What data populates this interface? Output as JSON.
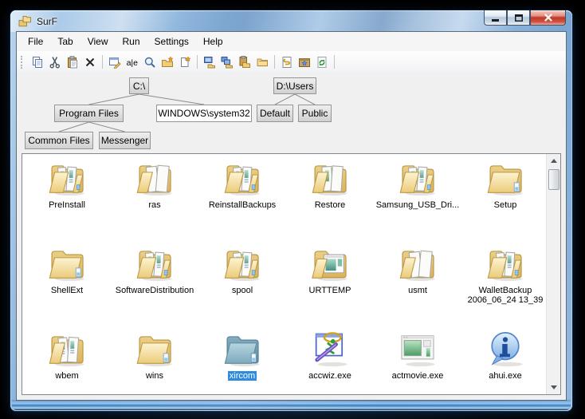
{
  "window": {
    "title": "SurF",
    "app_icon": "folders-app-icon",
    "controls": [
      {
        "name": "minimize-button",
        "icon": "minimize-icon"
      },
      {
        "name": "maximize-button",
        "icon": "maximize-icon"
      },
      {
        "name": "close-button",
        "icon": "close-icon"
      }
    ]
  },
  "menu": {
    "items": [
      "File",
      "Tab",
      "View",
      "Run",
      "Settings",
      "Help"
    ]
  },
  "toolbar": {
    "items": [
      {
        "name": "copy-icon"
      },
      {
        "name": "cut-icon"
      },
      {
        "name": "paste-icon"
      },
      {
        "name": "delete-icon"
      },
      {
        "name": "separator"
      },
      {
        "name": "properties-icon"
      },
      {
        "name": "rename-icon"
      },
      {
        "name": "search-icon"
      },
      {
        "name": "new-folder-icon"
      },
      {
        "name": "new-file-icon"
      },
      {
        "name": "separator"
      },
      {
        "name": "computer-folder-icon"
      },
      {
        "name": "network-folder-icon"
      },
      {
        "name": "paste-folder-icon"
      },
      {
        "name": "copy-folder-icon"
      },
      {
        "name": "separator"
      },
      {
        "name": "script-icon"
      },
      {
        "name": "archive-star-icon"
      },
      {
        "name": "refresh-icon"
      },
      {
        "name": "separator"
      }
    ]
  },
  "tab_tree": {
    "nodes": [
      {
        "id": "c",
        "label": "C:\\",
        "active": false,
        "root": true
      },
      {
        "id": "dusers",
        "label": "D:\\Users",
        "active": false,
        "root": true
      },
      {
        "id": "pf",
        "label": "Program Files",
        "active": false,
        "root": false
      },
      {
        "id": "sys32",
        "label": "WINDOWS\\system32",
        "active": true,
        "root": false
      },
      {
        "id": "default",
        "label": "Default",
        "active": false,
        "root": false
      },
      {
        "id": "public",
        "label": "Public",
        "active": false,
        "root": false
      },
      {
        "id": "common",
        "label": "Common Files",
        "active": false,
        "root": false
      },
      {
        "id": "messenger",
        "label": "Messenger",
        "active": false,
        "root": false
      }
    ],
    "edges": [
      [
        "c",
        "pf"
      ],
      [
        "c",
        "sys32"
      ],
      [
        "dusers",
        "default"
      ],
      [
        "dusers",
        "public"
      ],
      [
        "pf",
        "common"
      ],
      [
        "pf",
        "messenger"
      ]
    ]
  },
  "file_list": {
    "items": [
      {
        "label": "PreInstall",
        "icon": "folder-full",
        "selected": false
      },
      {
        "label": "ras",
        "icon": "folder-docs",
        "selected": false
      },
      {
        "label": "ReinstallBackups",
        "icon": "folder-full",
        "selected": false
      },
      {
        "label": "Restore",
        "icon": "folder-docs2",
        "selected": false
      },
      {
        "label": "Samsung_USB_Dri...",
        "icon": "folder-full",
        "selected": false
      },
      {
        "label": "Setup",
        "icon": "folder-empty",
        "selected": false
      },
      {
        "label": "ShellExt",
        "icon": "folder-empty",
        "selected": false
      },
      {
        "label": "SoftwareDistribution",
        "icon": "folder-full",
        "selected": false
      },
      {
        "label": "spool",
        "icon": "folder-full",
        "selected": false
      },
      {
        "label": "URTTEMP",
        "icon": "folder-app",
        "selected": false
      },
      {
        "label": "usmt",
        "icon": "folder-docs",
        "selected": false
      },
      {
        "label": "WalletBackup\n2006_06_24 13_39",
        "icon": "folder-full",
        "selected": false
      },
      {
        "label": "wbem",
        "icon": "folder-full2",
        "selected": false
      },
      {
        "label": "wins",
        "icon": "folder-empty",
        "selected": false
      },
      {
        "label": "xircom",
        "icon": "folder-blue",
        "selected": true
      },
      {
        "label": "accwiz.exe",
        "icon": "exe-wizard",
        "selected": false
      },
      {
        "label": "actmovie.exe",
        "icon": "exe-movie",
        "selected": false
      },
      {
        "label": "ahui.exe",
        "icon": "exe-info",
        "selected": false
      }
    ]
  },
  "scrollbar": {
    "up_arrow": "scroll-up-icon",
    "down_arrow": "scroll-down-icon",
    "thumb": "scroll-thumb"
  },
  "colors": {
    "selection": "#2e8be0",
    "tab_active_bg": "#ffffff",
    "tab_bg": "#d9d9d9",
    "titlebar_glass": "#8fb6de",
    "close_button": "#bf392b",
    "list_border": "#828790",
    "client_bg": "#f0f0f0"
  }
}
